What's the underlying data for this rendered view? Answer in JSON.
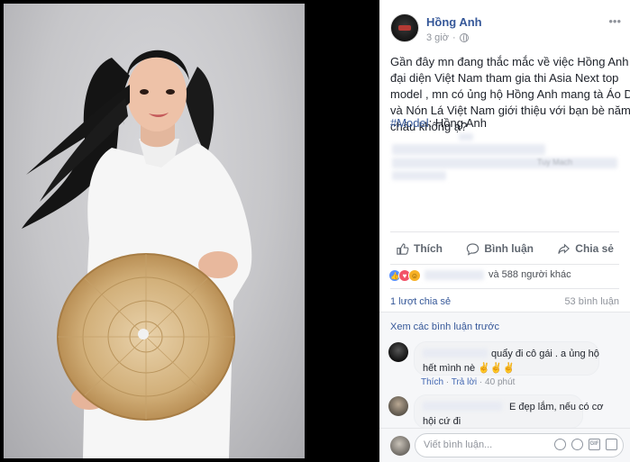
{
  "post": {
    "author": "Hồng Anh",
    "time": "3 giờ",
    "text_lines": [
      "Gần đây mn đang thắc mắc về việc Hồng Anh sẽ",
      "đại diện Việt Nam tham gia thi Asia Next top",
      "model , mn có ủng hộ Hồng Anh mang tà Áo Dài",
      "và Nón Lá Việt Nam giới thiệu với bạn bè năm",
      "châu không ạ?"
    ],
    "hashtag": "#Model",
    "hashtag_suffix": ": Hồng Anh",
    "blurred_fragment": "Tuy Mach"
  },
  "actions": {
    "like": "Thích",
    "comment": "Bình luận",
    "share": "Chia sẻ"
  },
  "stats": {
    "reactions_suffix": "và 588 người khác",
    "shares": "1 lượt chia sẻ",
    "comments": "53 bình luận"
  },
  "comments_section": {
    "view_previous": "Xem các bình luận trước",
    "comments": [
      {
        "line1": "quẩy đi cô gái . a ủng hộ",
        "line2": "hết mình nè",
        "like": "Thích",
        "reply": "Trả lời",
        "time": "40 phút"
      },
      {
        "line1": "E đẹp lắm, nếu có cơ",
        "line2": "hội cứ đi"
      }
    ],
    "input_placeholder": "Viết bình luận..."
  },
  "colors": {
    "link": "#365899",
    "muted": "#90949c",
    "like_reaction": "#5890ff",
    "love_reaction": "#f25268",
    "haha_reaction": "#f7b125"
  }
}
